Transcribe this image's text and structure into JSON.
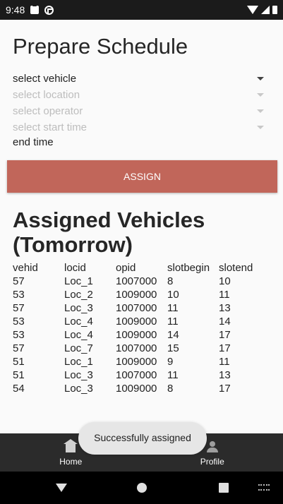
{
  "status_bar": {
    "time": "9:48",
    "icons": [
      "sd-card-icon",
      "data-saver-icon",
      "wifi-icon",
      "signal-icon",
      "battery-icon"
    ]
  },
  "page": {
    "title": "Prepare Schedule"
  },
  "form": {
    "vehicle_placeholder": "select vehicle",
    "location_placeholder": "select location",
    "operator_placeholder": "select operator",
    "start_time_placeholder": "select start time",
    "end_time_label": "end time",
    "assign_label": "ASSIGN"
  },
  "assigned": {
    "title": "Assigned Vehicles (Tomorrow)",
    "columns": [
      "vehid",
      "locid",
      "opid",
      "slotbegin",
      "slotend"
    ],
    "rows": [
      [
        "57",
        "Loc_1",
        "1007000",
        "8",
        "10"
      ],
      [
        "53",
        "Loc_2",
        "1009000",
        "10",
        "11"
      ],
      [
        "57",
        "Loc_3",
        "1007000",
        "11",
        "13"
      ],
      [
        "53",
        "Loc_4",
        "1009000",
        "11",
        "14"
      ],
      [
        "53",
        "Loc_4",
        "1009000",
        "14",
        "17"
      ],
      [
        "57",
        "Loc_7",
        "1007000",
        "15",
        "17"
      ],
      [
        "51",
        "Loc_1",
        "1009000",
        "9",
        "11"
      ],
      [
        "51",
        "Loc_3",
        "1007000",
        "11",
        "13"
      ],
      [
        "54",
        "Loc_3",
        "1009000",
        "8",
        "17"
      ]
    ]
  },
  "bottom_nav": {
    "home_label": "Home",
    "profile_label": "Profile"
  },
  "toast": {
    "message": "Successfully assigned"
  },
  "colors": {
    "assign_button": "#c1665a",
    "status_bar": "#1b1b1b",
    "bottom_nav": "#2b2b2b"
  }
}
